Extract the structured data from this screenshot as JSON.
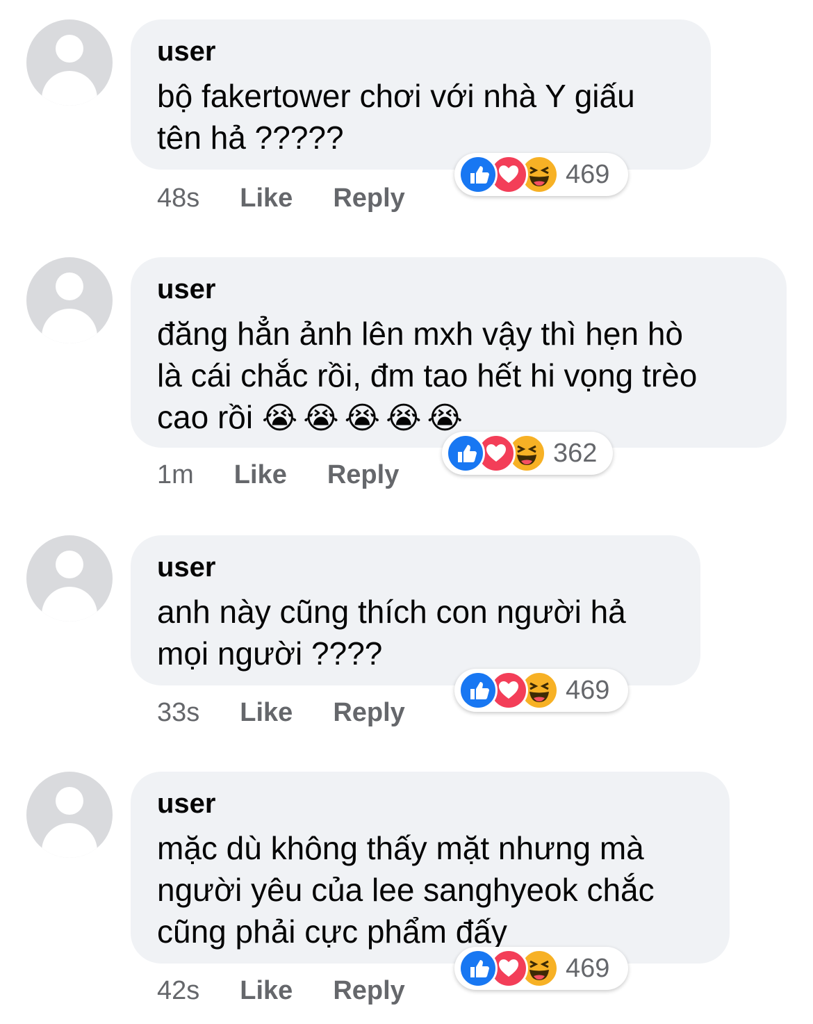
{
  "comments": [
    {
      "username": "user",
      "text": "bộ fakertower chơi với nhà Y giấu\ntên hả ?????",
      "emoji": "",
      "time": "48s",
      "like_label": "Like",
      "reply_label": "Reply",
      "reaction_count": "469"
    },
    {
      "username": "user",
      "text": "đăng hẳn ảnh lên mxh vậy thì hẹn hò\nlà cái chắc rồi, đm tao hết hi vọng trèo\ncao rồi ",
      "emoji": "😭😭😭😭😭",
      "time": "1m",
      "like_label": "Like",
      "reply_label": "Reply",
      "reaction_count": "362"
    },
    {
      "username": "user",
      "text": "anh này cũng thích con người hả\nmọi người ????",
      "emoji": "",
      "time": "33s",
      "like_label": "Like",
      "reply_label": "Reply",
      "reaction_count": "469"
    },
    {
      "username": "user",
      "text": "mặc dù không thấy mặt nhưng mà\nngười yêu của lee sanghyeok chắc\ncũng phải cực phẩm đấy",
      "emoji": "",
      "time": "42s",
      "like_label": "Like",
      "reply_label": "Reply",
      "reaction_count": "469"
    }
  ],
  "reaction_icons": [
    "like-icon",
    "love-icon",
    "haha-icon"
  ],
  "colors": {
    "bubble": "#f0f2f5",
    "secondary_text": "#65676b",
    "like_blue": "#1877f2",
    "love_red": "#f33e58",
    "haha_yellow": "#f7b125"
  }
}
